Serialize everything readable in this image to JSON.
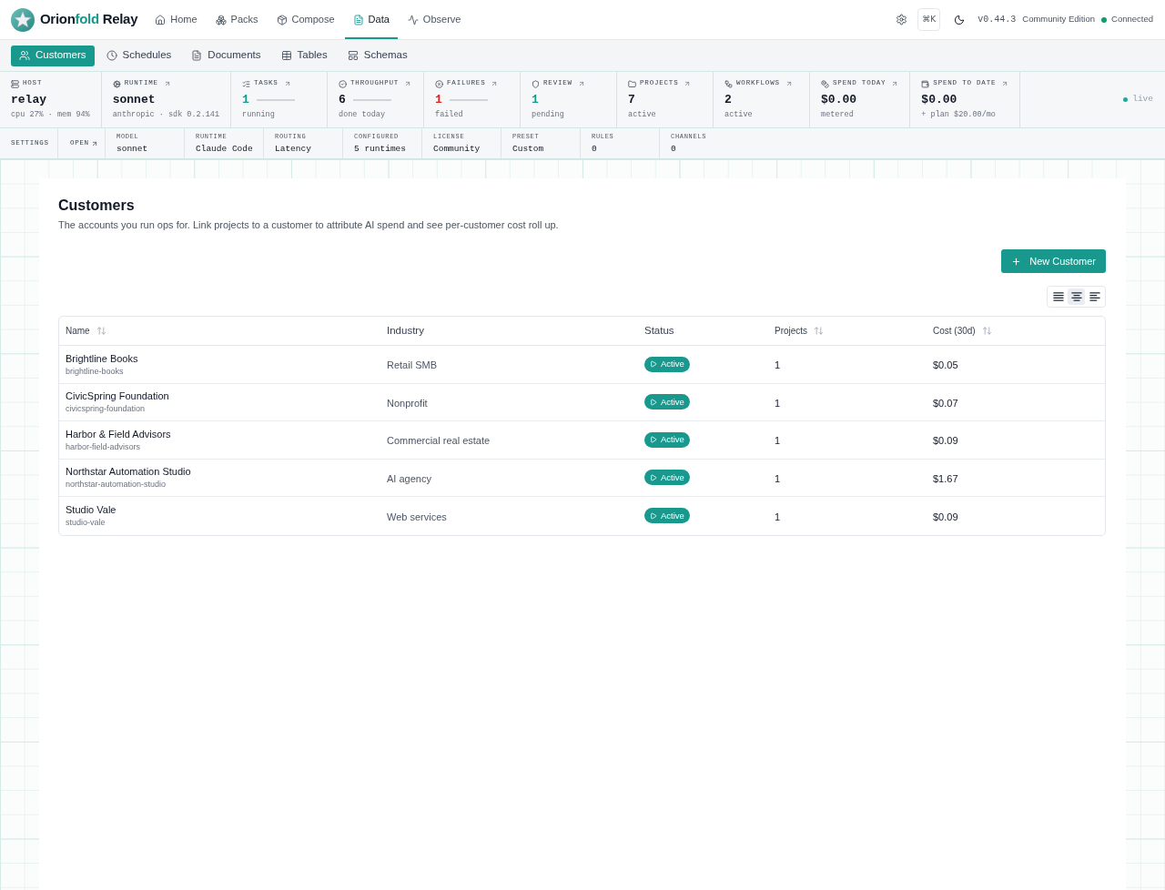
{
  "brand": [
    {
      "text": "Orion",
      "accent": false
    },
    {
      "text": "fold",
      "accent": true
    },
    {
      "text": " Relay",
      "accent": false
    }
  ],
  "nav": [
    {
      "label": "Home",
      "selected": false
    },
    {
      "label": "Packs",
      "selected": false
    },
    {
      "label": "Compose",
      "selected": false
    },
    {
      "label": "Data",
      "selected": true
    },
    {
      "label": "Observe",
      "selected": false
    }
  ],
  "header_right": {
    "shortcut": "⌘K",
    "version": "v0.44.3",
    "edition": "Community Edition",
    "connection": {
      "label": "Connected",
      "online": true
    }
  },
  "subnav": [
    {
      "label": "Customers",
      "selected": true
    },
    {
      "label": "Schedules",
      "selected": false
    },
    {
      "label": "Documents",
      "selected": false
    },
    {
      "label": "Tables",
      "selected": false
    },
    {
      "label": "Schemas",
      "selected": false
    }
  ],
  "stats": [
    {
      "label": "HOST",
      "linked": false,
      "value": "relay",
      "detail": "cpu 27% · mem 94%",
      "color": "#111827",
      "kind": "plain"
    },
    {
      "label": "RUNTIME",
      "linked": true,
      "value": "sonnet",
      "detail": "anthropic · sdk 0.2.141",
      "color": "#111827",
      "kind": "plain"
    },
    {
      "label": "TASKS",
      "linked": true,
      "value": "1",
      "detail": "running",
      "color": "#19998e",
      "kind": "trend"
    },
    {
      "label": "THROUGHPUT",
      "linked": true,
      "value": "6",
      "detail": "done today",
      "color": "#111827",
      "kind": "trend"
    },
    {
      "label": "FAILURES",
      "linked": true,
      "value": "1",
      "detail": "failed",
      "color": "#dc2626",
      "kind": "trend"
    },
    {
      "label": "REVIEW",
      "linked": true,
      "value": "1",
      "detail": "pending",
      "color": "#19998e",
      "kind": "plain"
    },
    {
      "label": "PROJECTS",
      "linked": true,
      "value": "7",
      "detail": "active",
      "color": "#111827",
      "kind": "plain"
    },
    {
      "label": "WORKFLOWS",
      "linked": true,
      "value": "2",
      "detail": "active",
      "color": "#111827",
      "kind": "plain"
    },
    {
      "label": "SPEND TODAY",
      "linked": true,
      "value": "$0.00",
      "detail": "metered",
      "color": "#111827",
      "kind": "plain"
    },
    {
      "label": "SPEND TO DATE",
      "linked": true,
      "value": "$0.00",
      "detail": "+ plan $20.00/mo",
      "color": "#111827",
      "kind": "plain"
    }
  ],
  "live": {
    "label": "live",
    "on": true
  },
  "settings_bar": {
    "title": "SETTINGS",
    "open_link": "OPEN",
    "fields": [
      {
        "label": "MODEL",
        "value": "sonnet"
      },
      {
        "label": "RUNTIME",
        "value": "Claude Code"
      },
      {
        "label": "ROUTING",
        "value": "Latency"
      },
      {
        "label": "CONFIGURED",
        "value": "5 runtimes"
      },
      {
        "label": "LICENSE",
        "value": "Community"
      },
      {
        "label": "PRESET",
        "value": "Custom"
      },
      {
        "label": "RULES",
        "value": "0"
      },
      {
        "label": "CHANNELS",
        "value": "0"
      }
    ]
  },
  "page": {
    "title": "Customers",
    "description": "The accounts you run ops for. Link projects to a customer to attribute AI spend and see per-customer cost roll up.",
    "primary_action": "New Customer",
    "view_options": [
      {
        "selected": false
      },
      {
        "selected": true
      },
      {
        "selected": false
      }
    ]
  },
  "table": {
    "columns": [
      {
        "label": "Name",
        "sortable": true
      },
      {
        "label": "Industry",
        "sortable": false
      },
      {
        "label": "Status",
        "sortable": false
      },
      {
        "label": "Projects",
        "sortable": true
      },
      {
        "label": "Cost (30d)",
        "sortable": true
      }
    ],
    "rows": [
      {
        "name": "Brightline Books",
        "slug": "brightline-books",
        "industry": "Retail SMB",
        "status": "Active",
        "projects": "1",
        "cost": "$0.05"
      },
      {
        "name": "CivicSpring Foundation",
        "slug": "civicspring-foundation",
        "industry": "Nonprofit",
        "status": "Active",
        "projects": "1",
        "cost": "$0.07"
      },
      {
        "name": "Harbor & Field Advisors",
        "slug": "harbor-field-advisors",
        "industry": "Commercial real estate",
        "status": "Active",
        "projects": "1",
        "cost": "$0.09"
      },
      {
        "name": "Northstar Automation Studio",
        "slug": "northstar-automation-studio",
        "industry": "AI agency",
        "status": "Active",
        "projects": "1",
        "cost": "$1.67"
      },
      {
        "name": "Studio Vale",
        "slug": "studio-vale",
        "industry": "Web services",
        "status": "Active",
        "projects": "1",
        "cost": "$0.09"
      }
    ]
  }
}
